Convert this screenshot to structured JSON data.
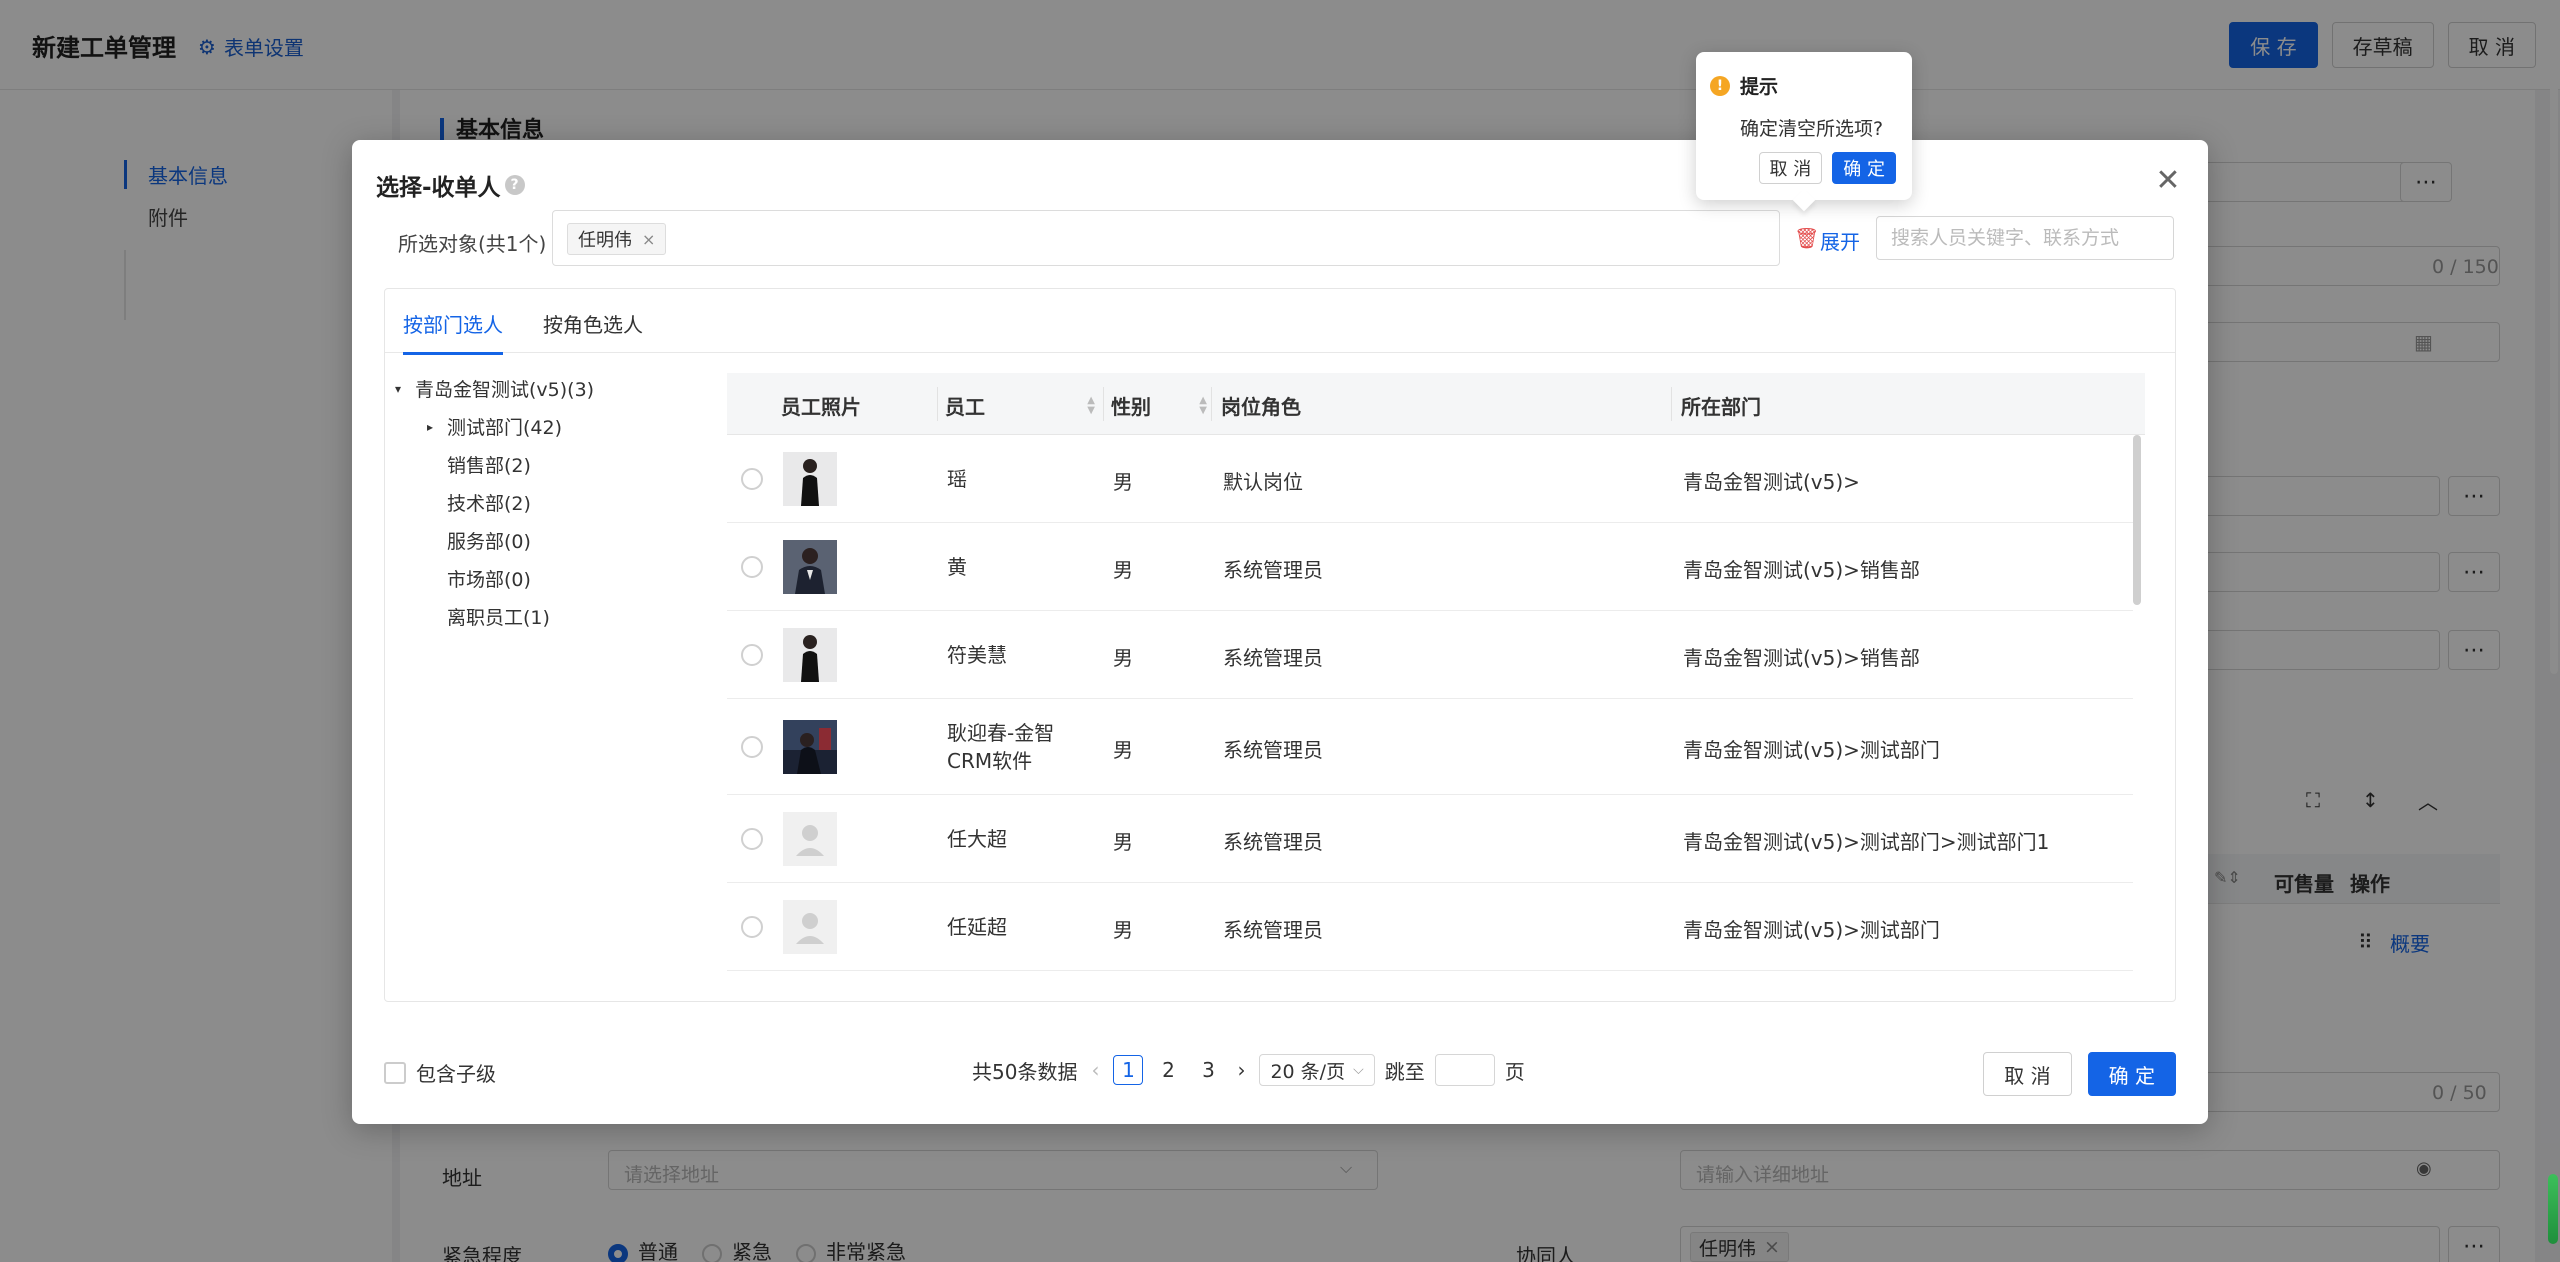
{
  "app": {
    "title": "新建工单管理",
    "form_settings": "表单设置",
    "save": "保 存",
    "draft": "存草稿",
    "cancel": "取 消"
  },
  "leftnav": {
    "items": [
      "基本信息",
      "附件"
    ]
  },
  "main": {
    "section_title": "基本信息",
    "counter1": "0 / 150",
    "counter2": "0 / 50",
    "table_headers": {
      "sellable": "可售量",
      "actions": "操作"
    },
    "summary_link": "概要",
    "address_label": "地址",
    "address_placeholder": "请选择地址",
    "detail_address_placeholder": "请输入详细地址",
    "urgency_label": "紧急程度",
    "urgency_options": [
      "普通",
      "紧急",
      "非常紧急"
    ],
    "collaborator_label": "协同人",
    "collaborator_tag": "任明伟"
  },
  "modal": {
    "title": "选择-收单人",
    "selected_label": "所选对象(共1个)",
    "selected_tag": "任明伟",
    "expand": "展开",
    "search_placeholder": "搜索人员关键字、联系方式",
    "tabs": [
      "按部门选人",
      "按角色选人"
    ],
    "tree": [
      {
        "label": "青岛金智测试(v5)(3)",
        "level": 0,
        "caret": "expanded"
      },
      {
        "label": "测试部门(42)",
        "level": 1,
        "caret": "collapsed"
      },
      {
        "label": "销售部(2)",
        "level": 1,
        "caret": "none"
      },
      {
        "label": "技术部(2)",
        "level": 1,
        "caret": "none"
      },
      {
        "label": "服务部(0)",
        "level": 1,
        "caret": "none"
      },
      {
        "label": "市场部(0)",
        "level": 1,
        "caret": "none"
      },
      {
        "label": "离职员工(1)",
        "level": 1,
        "caret": "none"
      }
    ],
    "columns": [
      "员工照片",
      "员工",
      "性别",
      "岗位角色",
      "所在部门"
    ],
    "rows": [
      {
        "name": "瑶",
        "gender": "男",
        "role": "默认岗位",
        "dept": "青岛金智测试(v5)>",
        "photo": "photo-black-dress"
      },
      {
        "name": "黄",
        "gender": "男",
        "role": "系统管理员",
        "dept": "青岛金智测试(v5)>销售部",
        "photo": "photo-suit"
      },
      {
        "name": "符美慧",
        "gender": "男",
        "role": "系统管理员",
        "dept": "青岛金智测试(v5)>销售部",
        "photo": "photo-black-dress"
      },
      {
        "name": "耿迎春-金智CRM软件",
        "gender": "男",
        "role": "系统管理员",
        "dept": "青岛金智测试(v5)>测试部门",
        "photo": "photo-outdoor"
      },
      {
        "name": "任大超",
        "gender": "男",
        "role": "系统管理员",
        "dept": "青岛金智测试(v5)>测试部门>测试部门1",
        "photo": "default-avatar"
      },
      {
        "name": "任延超",
        "gender": "男",
        "role": "系统管理员",
        "dept": "青岛金智测试(v5)>测试部门",
        "photo": "default-avatar"
      }
    ],
    "include_children": "包含子级",
    "pager": {
      "total": "共50条数据",
      "pages": [
        "1",
        "2",
        "3"
      ],
      "current": "1",
      "page_size": "20 条/页",
      "jump_label": "跳至",
      "page_unit": "页"
    },
    "cancel": "取 消",
    "confirm": "确 定"
  },
  "popconfirm": {
    "title": "提示",
    "message": "确定清空所选项?",
    "cancel": "取 消",
    "confirm": "确 定"
  },
  "colors": {
    "primary": "#1464e6",
    "danger": "#e34d4d",
    "warning": "#f5a623"
  }
}
